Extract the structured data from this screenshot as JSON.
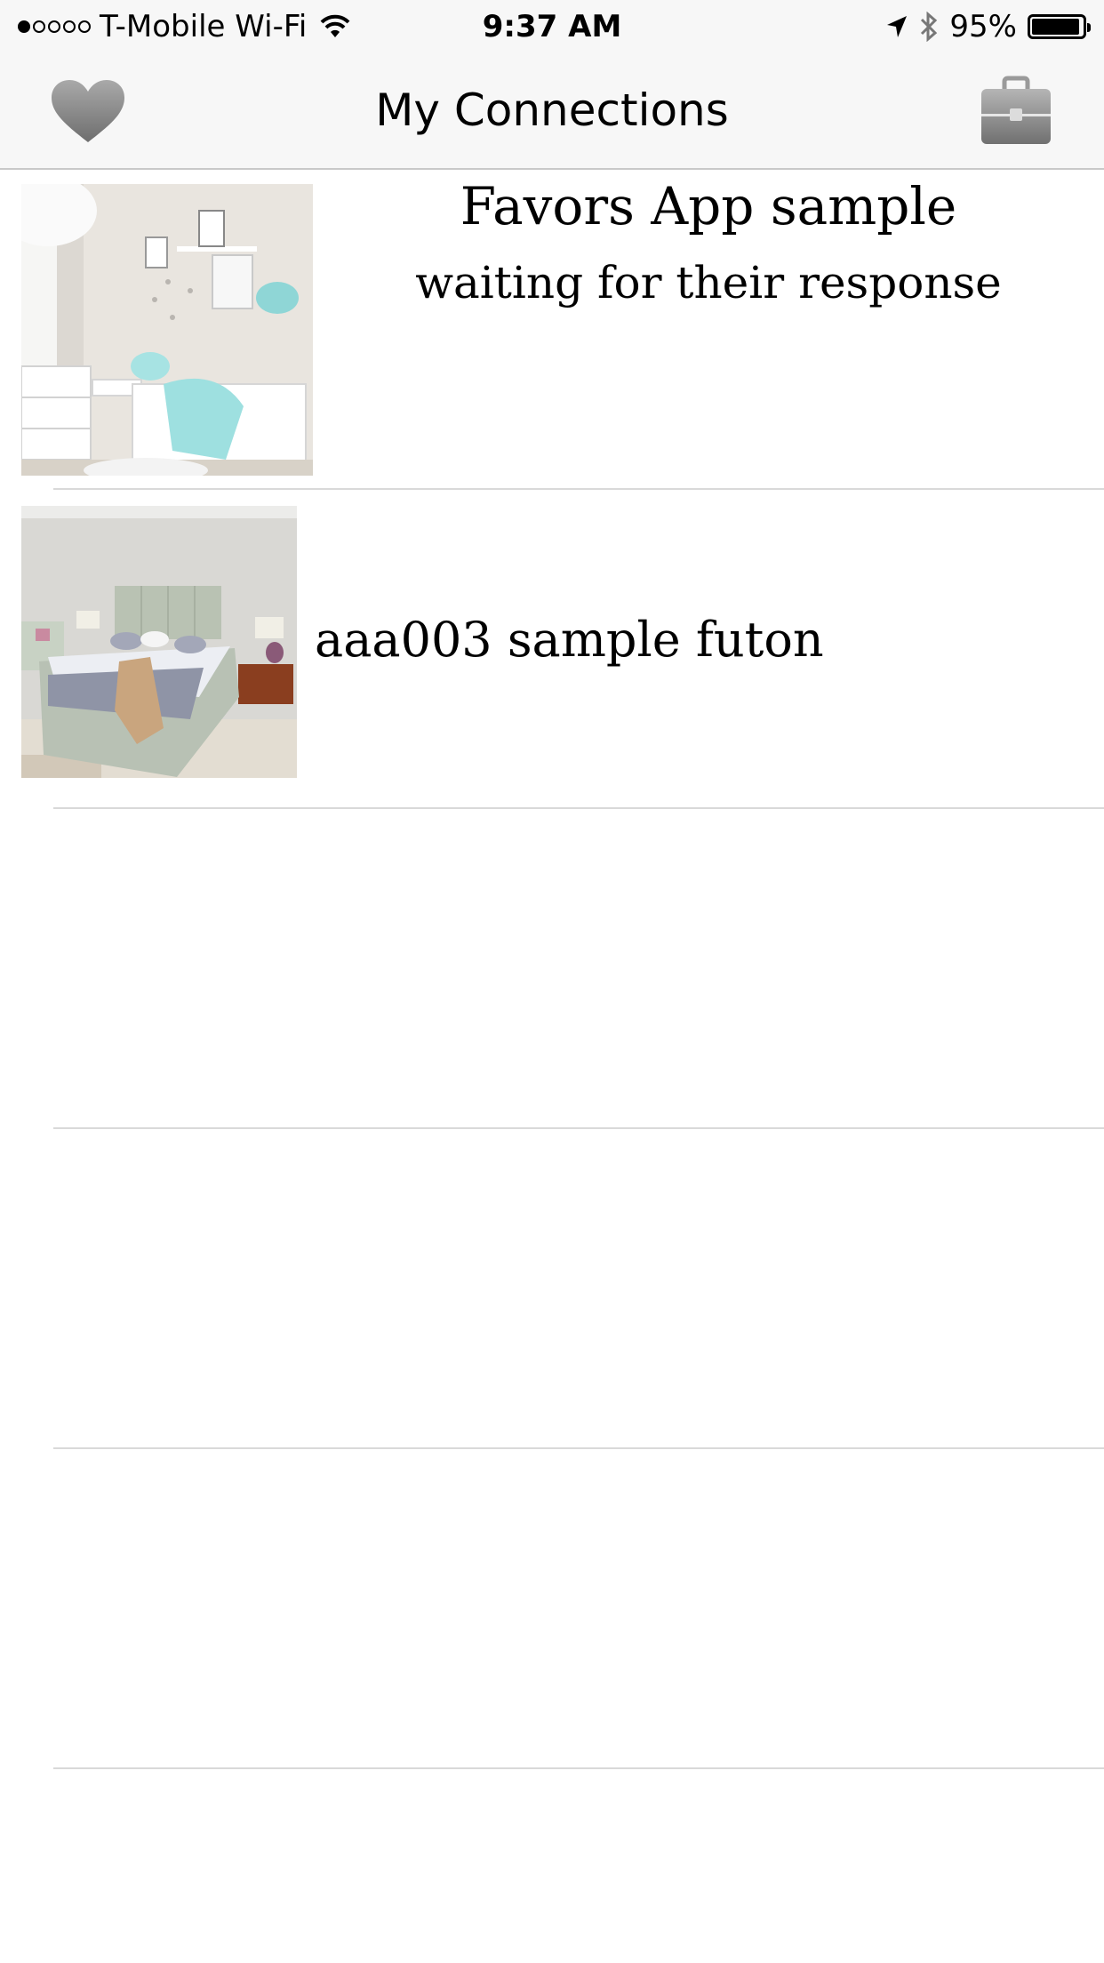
{
  "status_bar": {
    "carrier": "T-Mobile Wi-Fi",
    "time": "9:37 AM",
    "battery": "95%",
    "battery_level": 0.95,
    "signal_bars_filled": 1,
    "signal_bars_total": 5
  },
  "nav": {
    "title": "My Connections",
    "left_icon": "heart-icon",
    "right_icon": "briefcase-icon"
  },
  "connections": [
    {
      "title": "Favors App sample",
      "subtitle": "waiting for their response",
      "image": "kids-bedroom-photo"
    },
    {
      "title": "aaa003 sample futon",
      "image": "bedroom-futon-photo"
    }
  ],
  "colors": {
    "bar_background": "#f7f7f7",
    "separator": "#d9d9d9",
    "icon_gray": "#8e8e8e"
  }
}
